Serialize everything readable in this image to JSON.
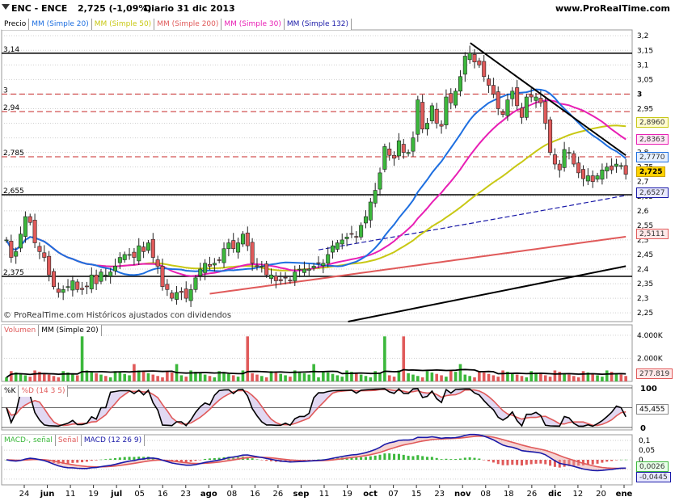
{
  "header": {
    "ticker": "ENC - ENCE",
    "quote": "2,725 (-1,09%)",
    "period": "Diario  31 dic 2013",
    "site": "www.ProRealTime.com"
  },
  "price_legend": [
    "Precio",
    "MM (Simple 20)",
    "MM (Simple 50)",
    "MM (Simple 200)",
    "MM (Simple 30)",
    "MM (Simple 132)"
  ],
  "volume_legend": [
    "Volumen",
    "MM (Simple 20)"
  ],
  "stoch_legend": [
    "%K",
    "%D (14 3 5)"
  ],
  "macd_legend": [
    "MACD-, señal",
    "Señal",
    "MACD (12 26 9)"
  ],
  "watermark": "© ProRealTime.com  Históricos ajustados con dividendos",
  "colors": {
    "up": "#3cb83c",
    "down": "#e05a5a",
    "sma20": "#1e6fe0",
    "sma50": "#c8c814",
    "sma200": "#e05a5a",
    "sma30": "#e81fb4",
    "sma132": "#1a1aa8",
    "grid": "#d0d0d0"
  },
  "price_axis_ticks": [
    "3,2",
    "3,15",
    "3,1",
    "3,05",
    "3",
    "2,95",
    "2,9",
    "2,85",
    "2,8",
    "2,75",
    "2,7",
    "2,65",
    "2,6",
    "2,55",
    "2,5",
    "2,45",
    "2,4",
    "2,35",
    "2,3",
    "2,25"
  ],
  "hline_labels": [
    "3,14",
    "3",
    "2,94",
    "2,785",
    "2,655",
    "2,375"
  ],
  "last_values": {
    "sma50": "2,8960",
    "sma30": "2,8363",
    "sma20": "2,7770",
    "price": "2,725",
    "sma132": "2,6527",
    "sma200": "2,5111",
    "volume": "277.819",
    "stoch": "45,455",
    "macd_signal": "0,0026",
    "macd": "-0,0445"
  },
  "volume_axis_ticks": [
    "4.000K",
    "2.000K"
  ],
  "stoch_axis_ticks": [
    "100",
    "50",
    "0"
  ],
  "macd_axis_ticks": [
    "0,1",
    "0,05",
    "0",
    "-0,05",
    "-0,1"
  ],
  "x_axis_labels": [
    "24",
    "jun",
    "11",
    "19",
    "jul",
    "05",
    "16",
    "23",
    "ago",
    "08",
    "16",
    "26",
    "sep",
    "11",
    "19",
    "oct",
    "07",
    "15",
    "23",
    "nov",
    "08",
    "18",
    "26",
    "dic",
    "12",
    "20",
    "ene"
  ],
  "chart_data": {
    "type": "candlestick",
    "title": "ENC - ENCE",
    "x_range": [
      "2013-05-24",
      "2014-01-02"
    ],
    "ylim": [
      2.22,
      3.22
    ],
    "closes": [
      2.5,
      2.44,
      2.46,
      2.52,
      2.58,
      2.56,
      2.49,
      2.46,
      2.44,
      2.38,
      2.34,
      2.32,
      2.33,
      2.34,
      2.36,
      2.33,
      2.33,
      2.34,
      2.38,
      2.35,
      2.39,
      2.38,
      2.39,
      2.41,
      2.44,
      2.45,
      2.45,
      2.44,
      2.48,
      2.46,
      2.49,
      2.44,
      2.41,
      2.34,
      2.33,
      2.3,
      2.32,
      2.32,
      2.3,
      2.33,
      2.37,
      2.4,
      2.42,
      2.41,
      2.42,
      2.43,
      2.47,
      2.49,
      2.47,
      2.49,
      2.52,
      2.48,
      2.42,
      2.41,
      2.41,
      2.38,
      2.38,
      2.36,
      2.36,
      2.37,
      2.36,
      2.39,
      2.4,
      2.4,
      2.4,
      2.41,
      2.42,
      2.42,
      2.45,
      2.48,
      2.49,
      2.5,
      2.51,
      2.52,
      2.51,
      2.55,
      2.58,
      2.63,
      2.67,
      2.73,
      2.82,
      2.79,
      2.78,
      2.84,
      2.8,
      2.8,
      2.85,
      2.98,
      2.88,
      2.9,
      2.96,
      2.9,
      2.89,
      2.99,
      2.97,
      3.01,
      3.06,
      3.13,
      3.14,
      3.11,
      3.1,
      3.06,
      3.03,
      3.0,
      2.95,
      2.93,
      2.98,
      3.01,
      2.96,
      2.92,
      2.99,
      2.99,
      2.99,
      2.97,
      2.9,
      2.8,
      2.76,
      2.74,
      2.81,
      2.8,
      2.76,
      2.73,
      2.71,
      2.72,
      2.7,
      2.72,
      2.74,
      2.75,
      2.74,
      2.76,
      2.755,
      2.725
    ],
    "series": [
      {
        "name": "Precio",
        "values": "closes"
      },
      {
        "name": "MM (Simple 20)",
        "last": 2.777
      },
      {
        "name": "MM (Simple 50)",
        "last": 2.896
      },
      {
        "name": "MM (Simple 200)",
        "last": 2.5111
      },
      {
        "name": "MM (Simple 30)",
        "last": 2.8363
      },
      {
        "name": "MM (Simple 132)",
        "last": 2.6527
      }
    ],
    "horizontal_levels": [
      3.14,
      3.0,
      2.94,
      2.785,
      2.655,
      2.375
    ],
    "trendlines": [
      {
        "from": [
          "2013-11-07",
          3.175
        ],
        "to": [
          "2014-01-02",
          2.79
        ]
      },
      {
        "from": [
          "2013-09-24",
          2.22
        ],
        "to": [
          "2014-01-02",
          2.41
        ]
      }
    ],
    "volume_max": 4900000,
    "stochastic_last": 45.455,
    "macd_last": {
      "macd": -0.0445,
      "signal": 0.0026
    }
  }
}
